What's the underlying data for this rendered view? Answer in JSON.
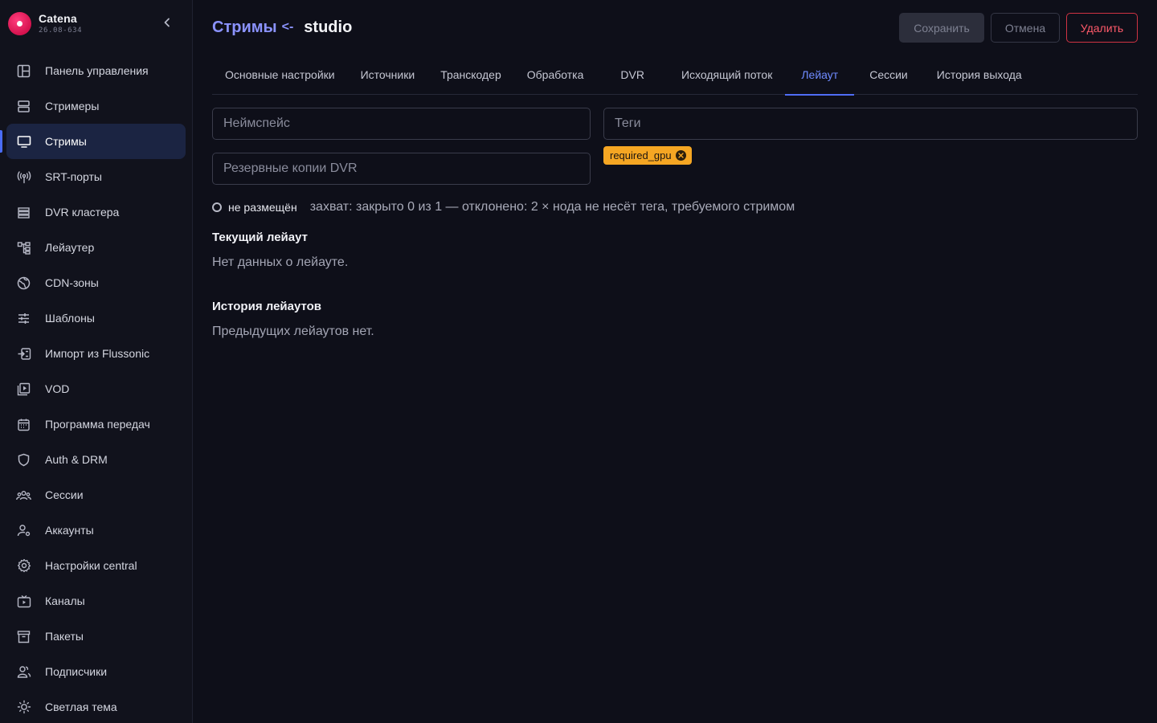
{
  "brand": {
    "name": "Catena",
    "version": "26.08-634"
  },
  "sidebar": {
    "items": [
      {
        "label": "Панель управления",
        "icon": "dashboard-icon"
      },
      {
        "label": "Стримеры",
        "icon": "servers-icon"
      },
      {
        "label": "Стримы",
        "icon": "monitor-icon",
        "active": true
      },
      {
        "label": "SRT-порты",
        "icon": "antenna-icon"
      },
      {
        "label": "DVR кластера",
        "icon": "storage-icon"
      },
      {
        "label": "Лейаутер",
        "icon": "layout-tree-icon"
      },
      {
        "label": "CDN-зоны",
        "icon": "globe-icon"
      },
      {
        "label": "Шаблоны",
        "icon": "sliders-icon"
      },
      {
        "label": "Импорт из Flussonic",
        "icon": "import-icon"
      },
      {
        "label": "VOD",
        "icon": "video-library-icon"
      },
      {
        "label": "Программа передач",
        "icon": "calendar-icon"
      },
      {
        "label": "Auth & DRM",
        "icon": "shield-icon"
      },
      {
        "label": "Сессии",
        "icon": "users-group-icon"
      },
      {
        "label": "Аккаунты",
        "icon": "user-settings-icon"
      },
      {
        "label": "Настройки central",
        "icon": "gear-icon"
      },
      {
        "label": "Каналы",
        "icon": "tv-icon"
      },
      {
        "label": "Пакеты",
        "icon": "archive-icon"
      },
      {
        "label": "Подписчики",
        "icon": "subscribers-icon"
      },
      {
        "label": "Светлая тема",
        "icon": "sun-icon"
      }
    ]
  },
  "header": {
    "breadcrumb_link": "Стримы",
    "breadcrumb_sep": "<-",
    "breadcrumb_current": "studio",
    "save_label": "Сохранить",
    "cancel_label": "Отмена",
    "delete_label": "Удалить"
  },
  "tabs": [
    {
      "label": "Основные настройки"
    },
    {
      "label": "Источники"
    },
    {
      "label": "Транскодер"
    },
    {
      "label": "Обработка"
    },
    {
      "label": "DVR"
    },
    {
      "label": "Исходящий поток"
    },
    {
      "label": "Лейаут",
      "active": true
    },
    {
      "label": "Сессии"
    },
    {
      "label": "История выхода"
    }
  ],
  "form": {
    "namespace_placeholder": "Неймспейс",
    "dvr_backup_placeholder": "Резервные копии DVR",
    "tags_placeholder": "Теги",
    "tags": [
      "required_gpu"
    ]
  },
  "status": {
    "label": "не размещён",
    "detail": "захват: закрыто 0 из 1 — отклонено: 2 × нода не несёт тега, требуемого стримом"
  },
  "current_layout": {
    "title": "Текущий лейаут",
    "text": "Нет данных о лейауте."
  },
  "layout_history": {
    "title": "История лейаутов",
    "text": "Предыдущих лейаутов нет."
  },
  "colors": {
    "accent": "#4a6cf7",
    "breadcrumb": "#8b93ff",
    "tag": "#f5a623",
    "danger": "#ff5a6a",
    "brand": "#e0185a"
  }
}
